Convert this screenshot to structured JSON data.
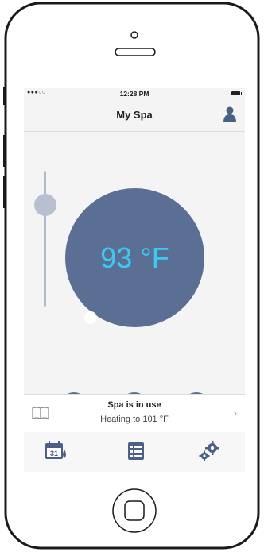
{
  "status_bar": {
    "signal": "●●●○○",
    "time": "12:28 PM"
  },
  "nav": {
    "title": "My Spa",
    "profile_icon": "person-icon"
  },
  "thermostat": {
    "temperature": "93 °F",
    "slider_level": 0.75
  },
  "controls": [
    {
      "name": "jets-1",
      "icon": "jets-icon"
    },
    {
      "name": "jets-2",
      "icon": "jets-icon"
    },
    {
      "name": "light",
      "icon": "light-ring-icon"
    }
  ],
  "info": {
    "title": "Spa is in use",
    "subtitle": "Heating to 101 °F",
    "chevron": "›"
  },
  "calendar_day": "31",
  "tabs": [
    {
      "name": "schedule",
      "icon": "calendar-drop-icon"
    },
    {
      "name": "list",
      "icon": "list-icon"
    },
    {
      "name": "settings",
      "icon": "gears-icon"
    }
  ],
  "colors": {
    "dial": "#5b6e93",
    "temperature_text": "#3cc9f2",
    "slider": "#b0b8c9"
  }
}
